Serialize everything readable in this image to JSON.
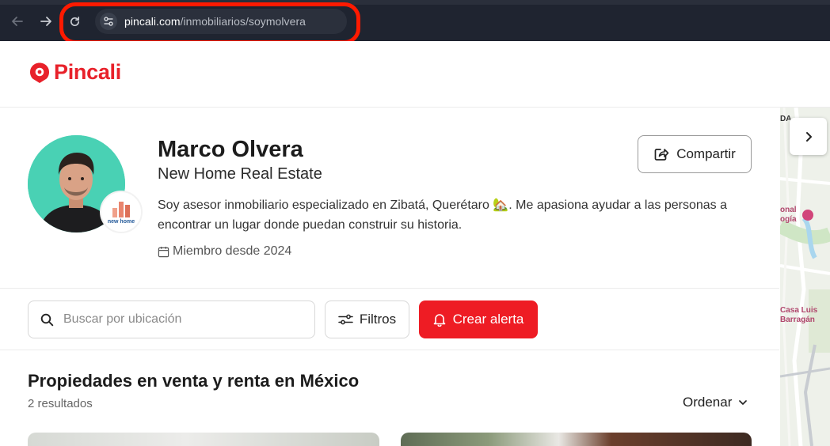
{
  "browser": {
    "url_host": "pincali.com",
    "url_path": "/inmobiliarios/soymolvera"
  },
  "header": {
    "logo_text": "Pincali",
    "brand_color": "#e8212a"
  },
  "profile": {
    "name": "Marco Olvera",
    "company": "New Home Real Estate",
    "bio": "Soy asesor inmobiliario especializado en Zibatá, Querétaro 🏡. Me apasiona ayudar a las personas a encontrar un lugar donde puedan construir su historia.",
    "member_since": "Miembro desde 2024",
    "badge_brand": "new home",
    "share_label": "Compartir"
  },
  "search": {
    "placeholder": "Buscar por ubicación",
    "filters_label": "Filtros",
    "alert_label": "Crear alerta",
    "alert_color": "#ee1c24"
  },
  "listings": {
    "title": "Propiedades en venta y renta en México",
    "count": "2 resultados",
    "sort_label": "Ordenar"
  },
  "map": {
    "labels": [
      "DA",
      "onal",
      "ogía",
      "Casa Luis",
      "Barragán"
    ]
  },
  "icons": {
    "back": "arrow-left-icon",
    "forward": "arrow-right-icon",
    "reload": "reload-icon",
    "site_settings": "tune-icon",
    "share": "share-icon",
    "calendar": "calendar-icon",
    "search": "search-icon",
    "filters": "sliders-icon",
    "bell": "bell-icon",
    "chevron": "chevron-down-icon",
    "map_next": "chevron-right-icon"
  }
}
